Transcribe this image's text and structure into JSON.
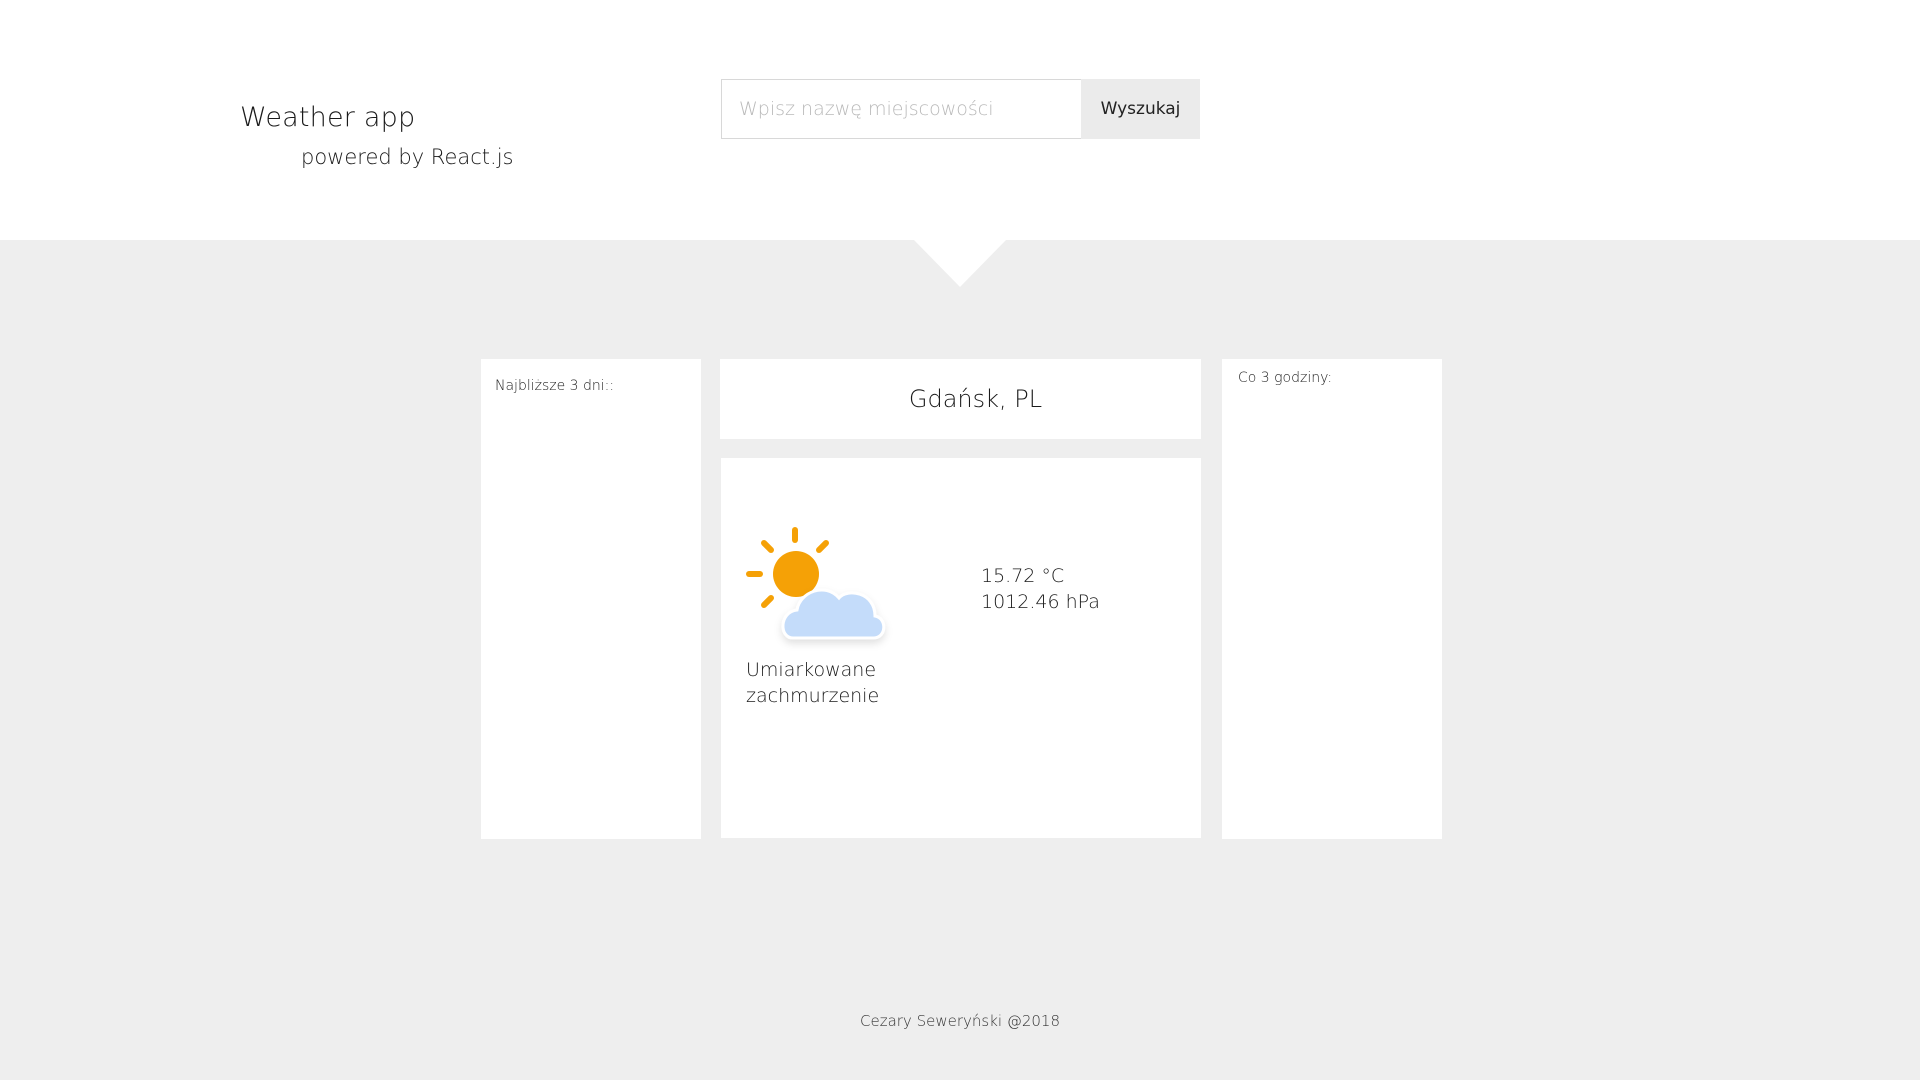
{
  "header": {
    "title": "Weather app",
    "subtitle": "powered by React.js"
  },
  "search": {
    "placeholder": "Wpisz nazwę miejscowości",
    "value": "",
    "button_label": "Wyszukaj"
  },
  "forecast_days": {
    "label": "Najbliższe 3 dni::"
  },
  "forecast_hours": {
    "label": "Co 3 godziny:"
  },
  "current": {
    "city": "Gdańsk, PL",
    "icon": "partly-cloudy-icon",
    "description": "Umiarkowane zachmurzenie",
    "temperature": "15.72 °C",
    "pressure": "1012.46 hPa"
  },
  "colors": {
    "sun": "#f5a106",
    "cloud": "#c4dcfa",
    "page_background": "#eeeeee"
  },
  "footer": {
    "text": "Cezary Seweryński @2018"
  }
}
